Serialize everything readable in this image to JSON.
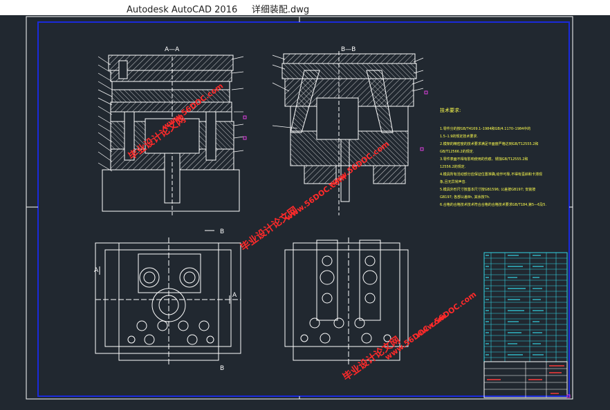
{
  "window": {
    "title": "Autodesk AutoCAD 2016     详细装配.dwg"
  },
  "drawing": {
    "section_aa": "A—A",
    "section_bb": "B—B",
    "view_label_a": "A",
    "view_label_b": "B",
    "tech_requirements_title": "技术要求:",
    "tech_requirements": [
      "1.零件分的按GB/T4169.1–1984和GB/4.1170–1984中的",
      "  1.5–1.9的规定技术要求.",
      "2.模架的精密度的技术要求满足平面度严格达到GB/T12555.2和",
      "  GB/T12566.2的规定.",
      "3.零件表面不得有影响使用的伤痕、锈蚀GB/T12555.2和",
      "  12556.2的规定.",
      "4.模具所有活动部分应保证位置准确,动作可靠,不得有歪斜和卡滞现",
      "  象,且无异常声音.",
      "5.模具外形尺寸按基本尺寸按GB1596; 公差按GB197; 安装按",
      "  GB197; 各部公差8h, 其余按7h.",
      "6.合格的合格技术技术符合合格的合格技术要求GB/T184,第5—6及5."
    ],
    "watermarks": [
      "毕业设计论文网",
      "www.56DOC.com"
    ]
  },
  "title_block": {
    "rows": 20
  },
  "colors": {
    "background": "#212830",
    "titlebar": "#ffffff",
    "border": "#ffffff",
    "inner_border": "#1a2adc",
    "geometry": "#ffffff",
    "text_yellow": "#ffff4d",
    "table_cyan": "#33d6e6",
    "table_red": "#ff3b3b",
    "watermark": "#ff2a2a",
    "marker": "#e040e0"
  }
}
